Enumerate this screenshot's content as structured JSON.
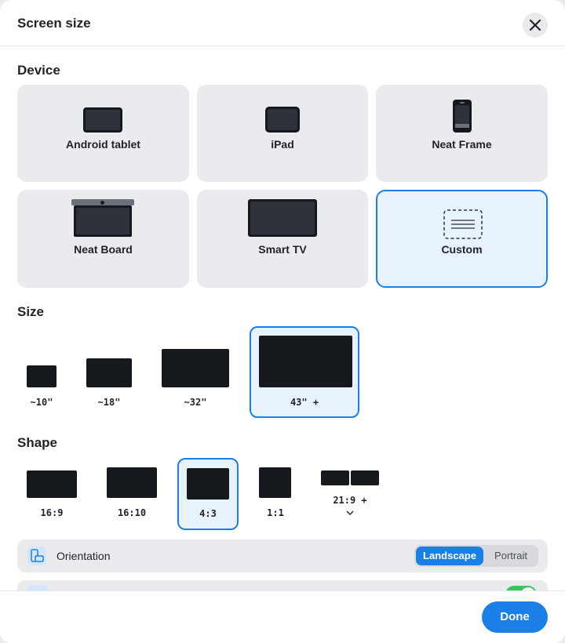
{
  "dialog": {
    "title": "Screen size"
  },
  "device": {
    "label": "Device",
    "items": [
      {
        "label": "Android tablet",
        "icon": "tablet-icon"
      },
      {
        "label": "iPad",
        "icon": "ipad-icon"
      },
      {
        "label": "Neat Frame",
        "icon": "phone-icon"
      },
      {
        "label": "Neat Board",
        "icon": "board-icon"
      },
      {
        "label": "Smart TV",
        "icon": "tv-icon"
      },
      {
        "label": "Custom",
        "icon": "custom-icon",
        "selected": true
      }
    ]
  },
  "size": {
    "label": "Size",
    "items": [
      {
        "label": "~10\""
      },
      {
        "label": "~18\""
      },
      {
        "label": "~32\""
      },
      {
        "label": "43\" +",
        "selected": true
      }
    ]
  },
  "shape": {
    "label": "Shape",
    "items": [
      {
        "label": "16:9"
      },
      {
        "label": "16:10"
      },
      {
        "label": "4:3",
        "selected": true
      },
      {
        "label": "1:1"
      },
      {
        "label": "21:9 +"
      }
    ]
  },
  "orientation": {
    "label": "Orientation",
    "options": [
      "Landscape",
      "Portrait"
    ],
    "selected": "Landscape"
  },
  "footer": {
    "done_label": "Done"
  },
  "colors": {
    "accent": "#1a7fe6",
    "toggle": "#34c759"
  }
}
